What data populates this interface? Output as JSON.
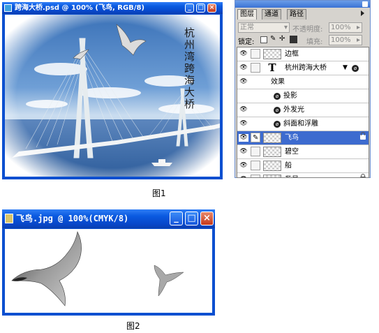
{
  "figure1": {
    "caption": "图1",
    "window": {
      "title": "跨海大桥.psd @ 100% (飞鸟, RGB/8)",
      "min_glyph": "_",
      "max_glyph": "□",
      "close_glyph": "×"
    },
    "canvas": {
      "vertical_text": "杭州湾跨海大桥"
    },
    "layers_panel": {
      "tabs": [
        "图层",
        "通道",
        "路径"
      ],
      "active_tab": "图层",
      "blend_mode": "正常",
      "opacity_label": "不透明度:",
      "opacity_value": "100%",
      "lock_label": "锁定:",
      "fill_label": "填充:",
      "fill_value": "100%",
      "layers": [
        {
          "name": "边框",
          "type": "normal",
          "visible": true
        },
        {
          "name": "杭州跨海大桥",
          "type": "text",
          "visible": true,
          "has_effects": true
        },
        {
          "name": "效果",
          "type": "effects-header",
          "visible": true
        },
        {
          "name": "投影",
          "type": "effect",
          "visible": false
        },
        {
          "name": "外发光",
          "type": "effect",
          "visible": true
        },
        {
          "name": "斜面和浮雕",
          "type": "effect",
          "visible": true
        },
        {
          "name": "飞鸟",
          "type": "normal",
          "visible": true,
          "selected": true,
          "locked": true
        },
        {
          "name": "碧空",
          "type": "normal",
          "visible": true
        },
        {
          "name": "船",
          "type": "normal",
          "visible": true
        },
        {
          "name": "背景",
          "type": "normal",
          "visible": true,
          "locked": true
        }
      ],
      "text_layer_glyph": "T",
      "fx_glyph": "ø"
    }
  },
  "figure2": {
    "caption": "图2",
    "window": {
      "title": "飞鸟.jpg @ 100%(CMYK/8)",
      "min_glyph": "_",
      "max_glyph": "□",
      "close_glyph": "×"
    }
  },
  "colors": {
    "xp_blue": "#0a4fd0",
    "selection": "#3d6bcf",
    "close_red": "#c6391a"
  }
}
